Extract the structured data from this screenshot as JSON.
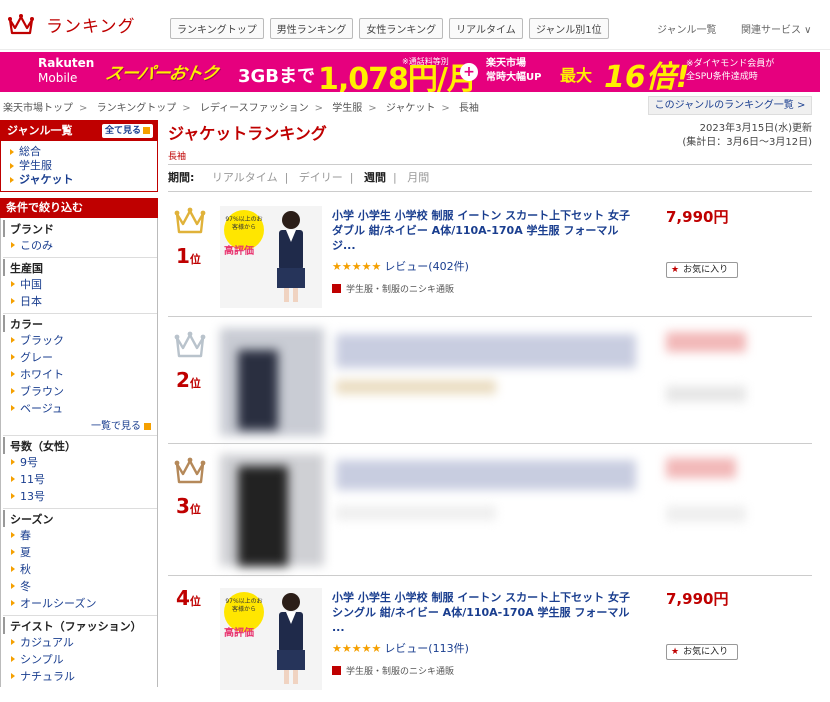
{
  "header": {
    "logo_text": "ランキング",
    "tabs": [
      "ランキングトップ",
      "男性ランキング",
      "女性ランキング",
      "リアルタイム",
      "ジャンル別1位"
    ],
    "genre_list": "ジャンル一覧",
    "related_services": "関連サービス ∨"
  },
  "banner": {
    "brand_line1": "Rakuten",
    "brand_line2": "Mobile",
    "promo": "スーパーおトク",
    "gb": "3GBまで",
    "price": "1,078円/月",
    "price_note": "※通話料等別",
    "plus": "+",
    "rakuten_line1": "楽天市場",
    "rakuten_line2": "常時大幅UP",
    "max_label": "最大",
    "multiplier": "16倍!",
    "note_line1": "※ダイヤモンド会員が",
    "note_line2": "全SPU条件達成時"
  },
  "breadcrumb": [
    "楽天市場トップ",
    "ランキングトップ",
    "レディースファッション",
    "学生服",
    "ジャケット",
    "長袖"
  ],
  "genre_ranking_link": "このジャンルのランキング一覧 >",
  "sidebar": {
    "genre_title": "ジャンル一覧",
    "see_all": "全て見る",
    "genres": [
      "総合",
      "学生服",
      "ジャケット"
    ],
    "filter_title": "条件で絞り込む",
    "filters": [
      {
        "title": "ブランド",
        "items": [
          "このみ"
        ],
        "more": ""
      },
      {
        "title": "生産国",
        "items": [
          "中国",
          "日本"
        ],
        "more": ""
      },
      {
        "title": "カラー",
        "items": [
          "ブラック",
          "グレー",
          "ホワイト",
          "ブラウン",
          "ベージュ"
        ],
        "more": "一覧で見る"
      },
      {
        "title": "号数（女性）",
        "items": [
          "9号",
          "11号",
          "13号"
        ],
        "more": ""
      },
      {
        "title": "シーズン",
        "items": [
          "春",
          "夏",
          "秋",
          "冬",
          "オールシーズン"
        ],
        "more": ""
      },
      {
        "title": "テイスト（ファッション）",
        "items": [
          "カジュアル",
          "シンプル",
          "ナチュラル"
        ],
        "more": ""
      }
    ]
  },
  "main": {
    "title": "ジャケットランキング",
    "subtitle": "長袖",
    "date_line1": "2023年3月15日(水)更新",
    "date_line2": "(集計日：3月6日〜3月12日)",
    "period_label": "期間:",
    "periods": [
      "リアルタイム",
      "デイリー",
      "週間",
      "月間"
    ],
    "active_period": "週間"
  },
  "items": [
    {
      "rank": "1",
      "rank_suffix": "位",
      "title": "小学 小学生 小学校 制服 イートン スカート上下セット 女子 ダブル 紺/ネイビー A体/110A-170A 学生服 フォーマル ジ...",
      "stars": "★★★★★",
      "reviews": "レビュー(402件)",
      "shop": "学生服・制服のニシキ通販",
      "price": "7,990円",
      "fav": "お気に入り",
      "thumb_badge": "97%以上のお客様から",
      "thumb_head": "高評価"
    },
    {
      "rank": "2",
      "rank_suffix": "位"
    },
    {
      "rank": "3",
      "rank_suffix": "位"
    },
    {
      "rank": "4",
      "rank_suffix": "位",
      "title": "小学 小学生 小学校 制服 イートン スカート上下セット 女子 シングル 紺/ネイビー A体/110A-170A 学生服 フォーマル ...",
      "stars": "★★★★★",
      "reviews": "レビュー(113件)",
      "shop": "学生服・制服のニシキ通販",
      "price": "7,990円",
      "fav": "お気に入り",
      "thumb_badge": "97%以上のお客様から",
      "thumb_head": "高評価"
    }
  ],
  "colors": {
    "brand": "#bf0000",
    "banner": "#e6007e",
    "gold": "#e0b23a",
    "silver": "#b9c3cc",
    "bronze": "#b5895a"
  }
}
